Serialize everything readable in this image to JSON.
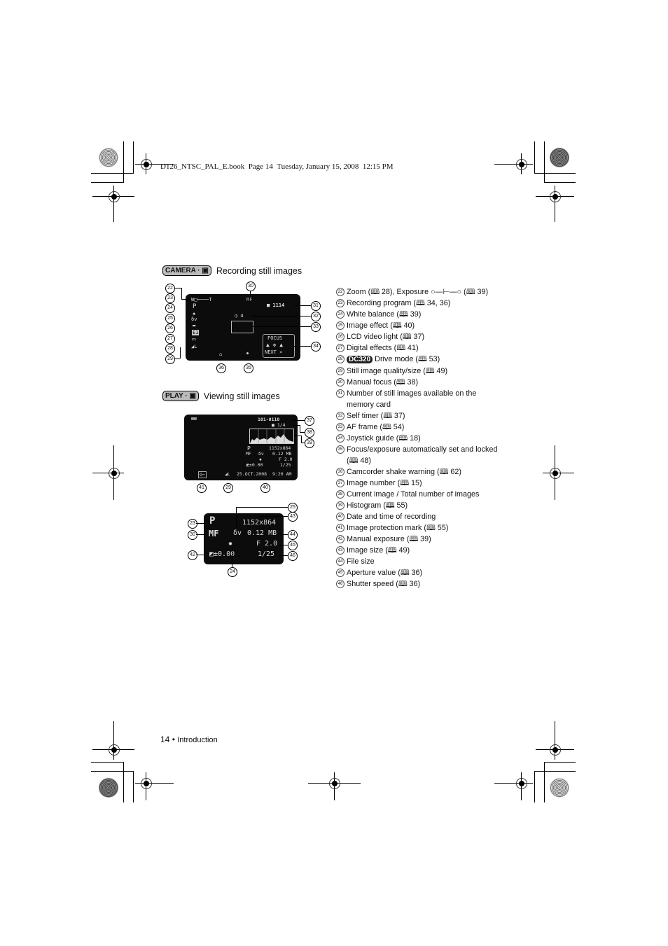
{
  "print_header": "D126_NTSC_PAL_E.book  Page 14  Tuesday, January 15, 2008  12:15 PM",
  "sections": {
    "recording": {
      "badge": "CAMERA · ▣",
      "title": "Recording still images"
    },
    "viewing": {
      "badge": "PLAY · ▣",
      "title": "Viewing still images"
    }
  },
  "camera_screen": {
    "zoom_bar": "W□────T",
    "program": "P",
    "white_balance": "✹",
    "image_effect": "δv",
    "lcd_light": "▬",
    "digital_effect": "E1",
    "drive_mode": "▭",
    "quality": "◢L",
    "manual_focus": "MF",
    "shots_remaining": "■ 1114",
    "self_timer": "◷ 4",
    "joystick_top": "FOCUS",
    "joystick_bottom": "NEXT »",
    "shake_warning": "⌂",
    "focus_lock": "●"
  },
  "play_screen": {
    "image_number": "101-0110",
    "current_total": "■ 1/4",
    "program": "P",
    "manual_focus": "MF",
    "image_effect": "δv",
    "white_balance": "✹",
    "exposure": "◩±0.00",
    "image_size": "1152x864",
    "file_size": "0.12 MB",
    "aperture": "F 2.0",
    "shutter": "1/25",
    "protect": "O─",
    "quality": "◢L",
    "date": "25.OCT.2008",
    "time": "9:20 AM"
  },
  "detail_screen": {
    "program": "P",
    "manual_focus": "MF",
    "image_effect": "δv",
    "white_balance": "✹",
    "exposure": "◩±0.00",
    "image_size": "1152x864",
    "file_size": "0.12 MB",
    "aperture": "F 2.0",
    "shutter": "1/25"
  },
  "callouts": {
    "c22": "22",
    "c23": "23",
    "c24": "24",
    "c25": "25",
    "c26": "26",
    "c27": "27",
    "c28": "28",
    "c29": "29",
    "c30": "30",
    "c31": "31",
    "c32": "32",
    "c33": "33",
    "c34": "34",
    "c35": "35",
    "c36": "36",
    "c37": "37",
    "c38": "38",
    "c39": "39",
    "c40": "40",
    "c41": "41",
    "c42": "42",
    "c43": "43",
    "c44": "44",
    "c45": "45",
    "c46": "46"
  },
  "legend": [
    {
      "num": "22",
      "text": "Zoom (🕮 28), Exposure ○—⊢—○ (🕮 39)"
    },
    {
      "num": "23",
      "text": "Recording program (🕮 34, 36)"
    },
    {
      "num": "24",
      "text": "White balance (🕮 39)"
    },
    {
      "num": "25",
      "text": "Image effect (🕮 40)"
    },
    {
      "num": "26",
      "text": "LCD video light (🕮 37)"
    },
    {
      "num": "27",
      "text": "Digital effects (🕮 41)"
    },
    {
      "num": "28",
      "model": "DC320",
      "text": "Drive mode (🕮 53)"
    },
    {
      "num": "29",
      "text": "Still image quality/size (🕮 49)"
    },
    {
      "num": "30",
      "text": "Manual focus (🕮 38)"
    },
    {
      "num": "31",
      "text": "Number of still images available on the memory card"
    },
    {
      "num": "32",
      "text": "Self timer (🕮 37)"
    },
    {
      "num": "33",
      "text": "AF frame (🕮 54)"
    },
    {
      "num": "34",
      "text": "Joystick guide (🕮 18)"
    },
    {
      "num": "35",
      "text": "Focus/exposure automatically set and locked (🕮 48)"
    },
    {
      "num": "36",
      "text": "Camcorder shake warning (🕮 62)"
    },
    {
      "num": "37",
      "text": "Image number (🕮 15)"
    },
    {
      "num": "38",
      "text": "Current image / Total number of images"
    },
    {
      "num": "39",
      "text": "Histogram (🕮 55)"
    },
    {
      "num": "40",
      "text": "Date and time of recording"
    },
    {
      "num": "41",
      "text": "Image protection mark (🕮 55)"
    },
    {
      "num": "42",
      "text": "Manual exposure (🕮 39)"
    },
    {
      "num": "43",
      "text": "Image size (🕮 49)"
    },
    {
      "num": "44",
      "text": "File size"
    },
    {
      "num": "45",
      "text": "Aperture value (🕮 36)"
    },
    {
      "num": "46",
      "text": "Shutter speed (🕮 36)"
    }
  ],
  "footer": {
    "page_number": "14",
    "bullet": "•",
    "section": "Introduction"
  }
}
